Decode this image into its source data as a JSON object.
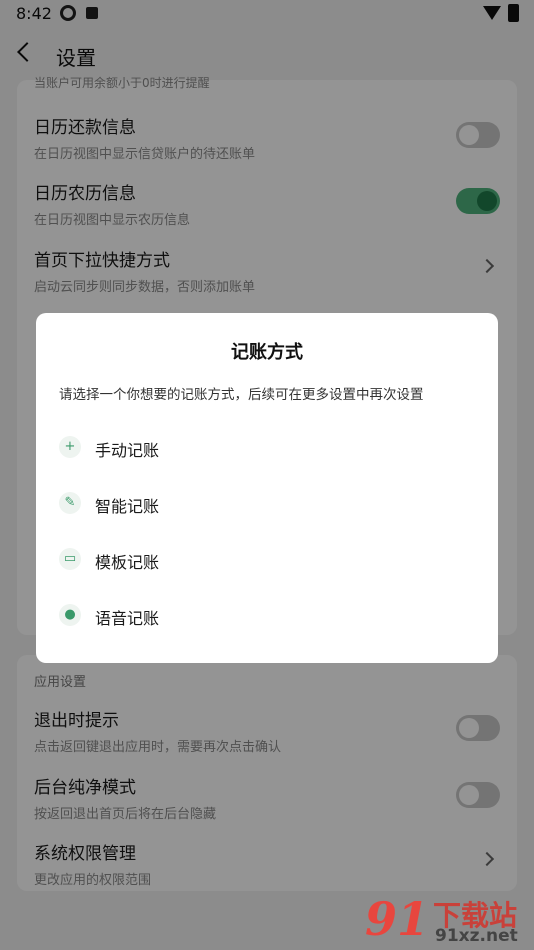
{
  "status_bar": {
    "time": "8:42"
  },
  "app_bar": {
    "title": "设置"
  },
  "cut_off_text": "当账户可用余额小于0时进行提醒",
  "settings_top": [
    {
      "title": "日历还款信息",
      "subtitle": "在日历视图中显示信贷账户的待还账单",
      "control": "toggle",
      "on": false
    },
    {
      "title": "日历农历信息",
      "subtitle": "在日历视图中显示农历信息",
      "control": "toggle",
      "on": true
    },
    {
      "title": "首页下拉快捷方式",
      "subtitle": "启动云同步则同步数据，否则添加账单",
      "control": "chevron"
    }
  ],
  "app_settings_section": {
    "label": "应用设置",
    "items": [
      {
        "title": "退出时提示",
        "subtitle": "点击返回键退出应用时，需要再次点击确认",
        "control": "toggle",
        "on": false
      },
      {
        "title": "后台纯净模式",
        "subtitle": "按返回退出首页后将在后台隐藏",
        "control": "toggle",
        "on": false
      },
      {
        "title": "系统权限管理",
        "subtitle": "更改应用的权限范围",
        "control": "chevron"
      }
    ]
  },
  "dialog": {
    "title": "记账方式",
    "description": "请选择一个你想要的记账方式，后续可在更多设置中再次设置",
    "options": [
      {
        "label": "手动记账",
        "icon": "plus-icon"
      },
      {
        "label": "智能记账",
        "icon": "pen-icon"
      },
      {
        "label": "模板记账",
        "icon": "template-icon"
      },
      {
        "label": "语音记账",
        "icon": "microphone-icon"
      }
    ]
  },
  "watermark": {
    "number": "91",
    "text": "下载站",
    "url": "91xz.net"
  },
  "colors": {
    "accent_green": "#3a9a6a",
    "toggle_on": "#4fb17c",
    "watermark_red": "#e8463e"
  }
}
